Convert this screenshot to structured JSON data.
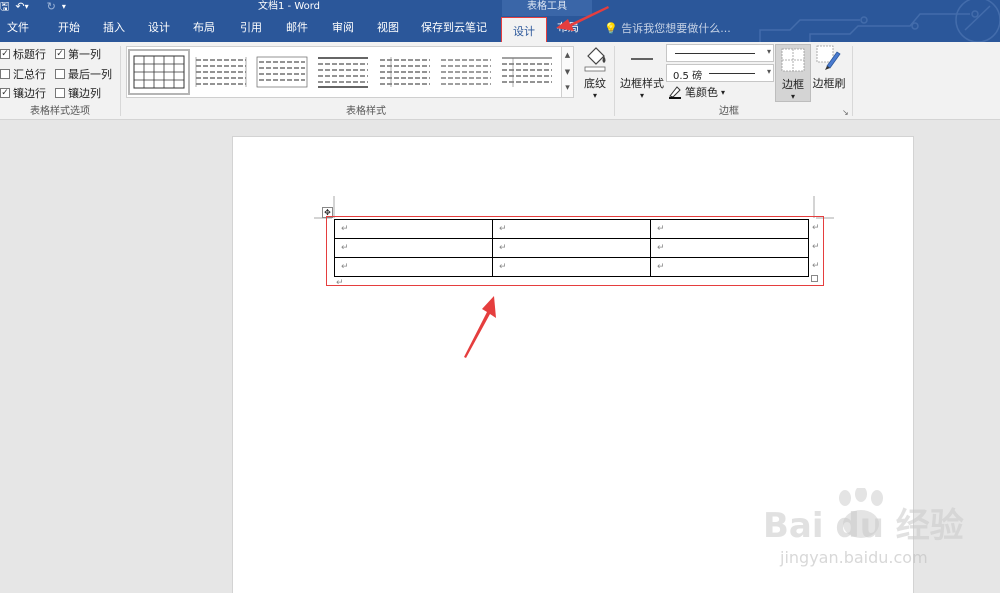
{
  "window": {
    "title": "文档1 - Word",
    "table_tools": "表格工具"
  },
  "qat": {
    "save": "🖫",
    "undo": "↶",
    "undo_arrow": "▾",
    "redo": "↻",
    "customize": "▾"
  },
  "tabs": [
    {
      "label": "文件"
    },
    {
      "label": "开始"
    },
    {
      "label": "插入"
    },
    {
      "label": "设计"
    },
    {
      "label": "布局"
    },
    {
      "label": "引用"
    },
    {
      "label": "邮件"
    },
    {
      "label": "审阅"
    },
    {
      "label": "视图"
    },
    {
      "label": "保存到云笔记"
    },
    {
      "label": "设计"
    },
    {
      "label": "布局"
    }
  ],
  "tell_me": "告诉我您想要做什么...",
  "style_options": {
    "group_label": "表格样式选项",
    "items": [
      {
        "label": "标题行",
        "checked": true
      },
      {
        "label": "第一列",
        "checked": true
      },
      {
        "label": "汇总行",
        "checked": false
      },
      {
        "label": "最后一列",
        "checked": false
      },
      {
        "label": "镶边行",
        "checked": true
      },
      {
        "label": "镶边列",
        "checked": false
      }
    ],
    "check_glyph": "✓"
  },
  "table_styles": {
    "group_label": "表格样式",
    "scroll_up": "▲",
    "scroll_down": "▼",
    "more": "▾"
  },
  "shading": {
    "label": "底纹",
    "arrow": "▾"
  },
  "borders": {
    "group_label": "边框",
    "border_styles_label": "边框样式",
    "border_styles_arrow": "▾",
    "weight": "0.5 磅",
    "pen_color_label": "笔颜色",
    "pen_color_arrow": "▾",
    "borders_label": "边框",
    "borders_arrow": "▾",
    "painter_label": "边框刷",
    "dropdown_arrow": "▾",
    "launcher": "↘"
  },
  "document": {
    "cell_mark": "↵",
    "move_handle": "✥",
    "rows": [
      [
        "↵",
        "↵",
        "↵"
      ],
      [
        "↵",
        "↵",
        "↵"
      ],
      [
        "↵",
        "↵",
        "↵"
      ]
    ]
  },
  "watermark": {
    "text": "Bai  du 经验",
    "url": "jingyan.baidu.com"
  },
  "colors": {
    "accent": "#2b579a",
    "highlight": "#e53e3e"
  }
}
